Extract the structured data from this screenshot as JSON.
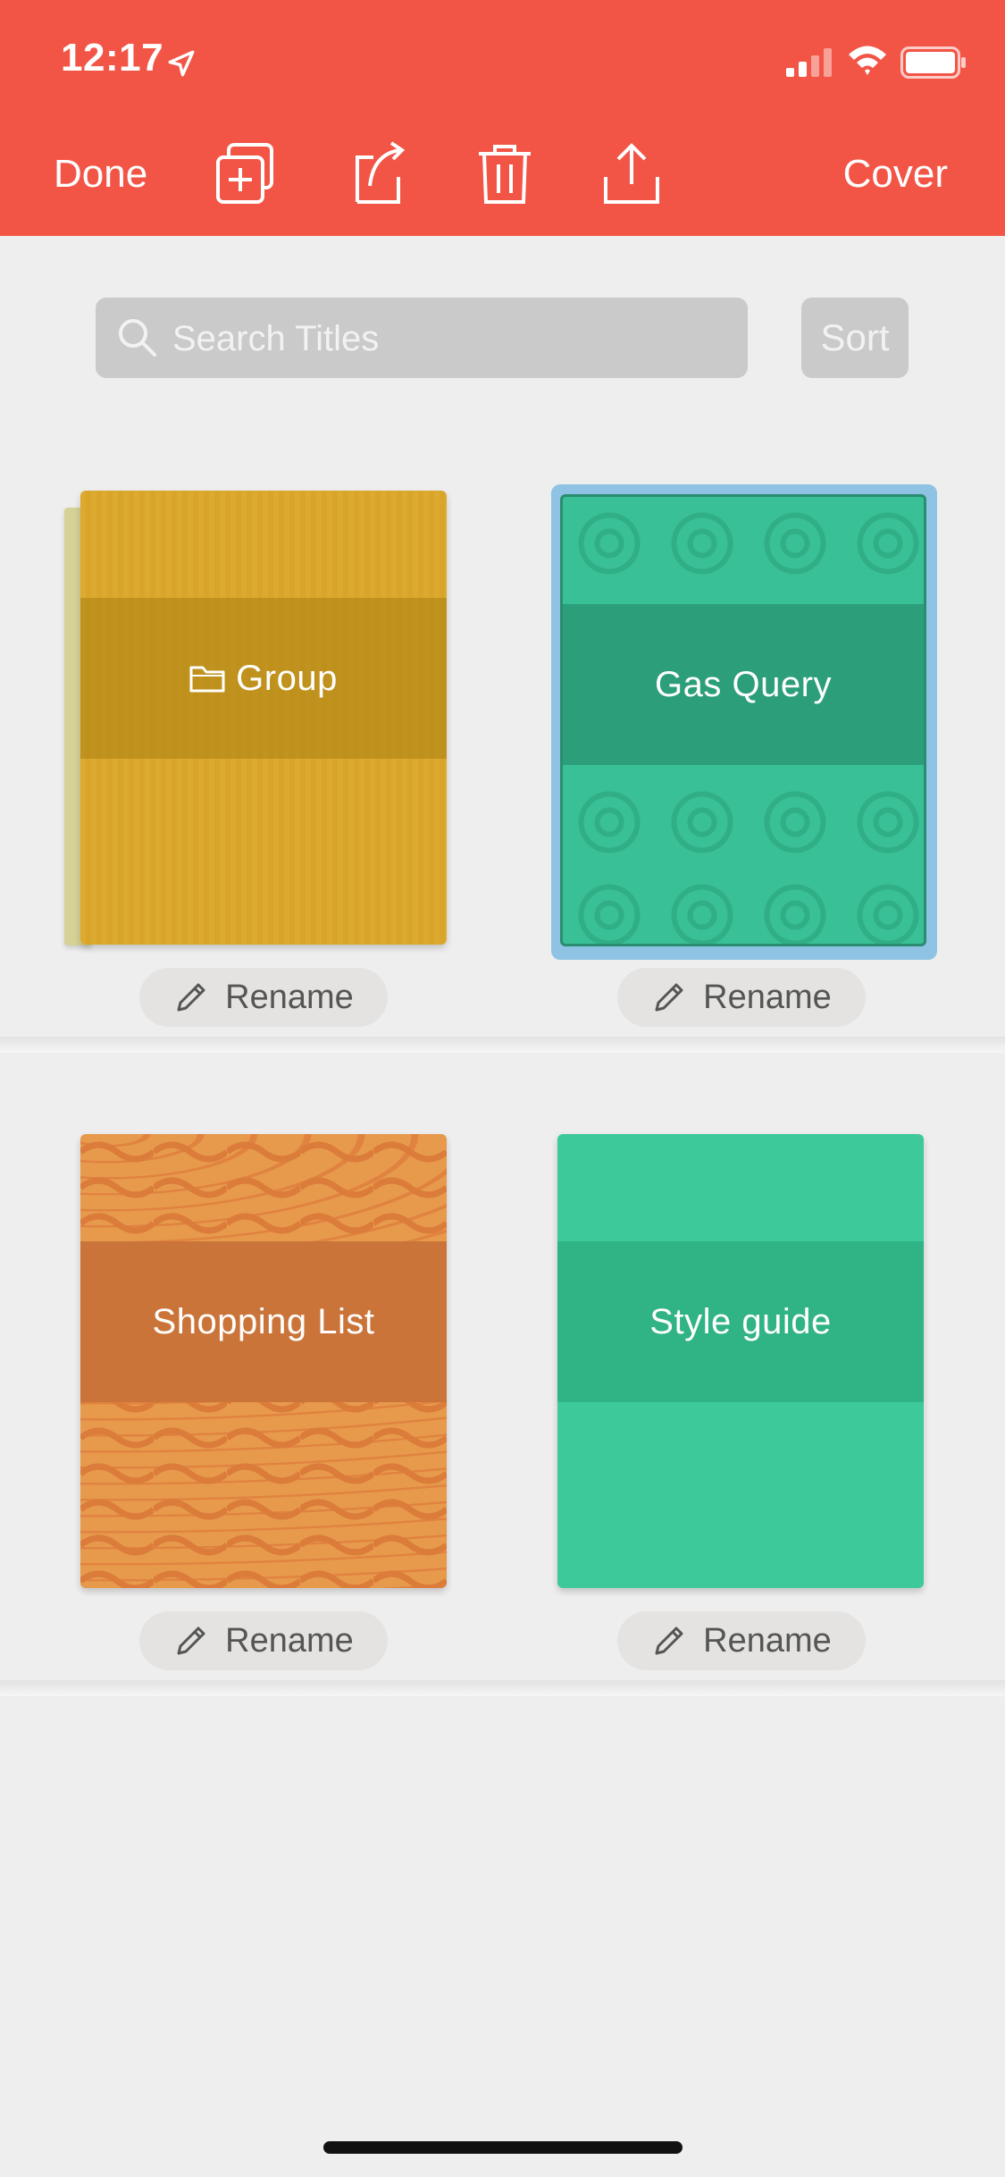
{
  "status_bar": {
    "time": "12:17",
    "icons": [
      "location-arrow-icon",
      "cellular-signal-icon",
      "wifi-icon",
      "battery-icon"
    ]
  },
  "toolbar": {
    "done_label": "Done",
    "cover_label": "Cover",
    "icons": [
      "duplicate-icon",
      "move-icon",
      "trash-icon",
      "share-icon"
    ],
    "background_color": "#f25546"
  },
  "search": {
    "placeholder": "Search Titles",
    "value": "",
    "sort_label": "Sort"
  },
  "items": [
    {
      "title": "Group",
      "type": "folder",
      "color": "#dcaa2e",
      "rename_label": "Rename",
      "selected": false
    },
    {
      "title": "Gas Query",
      "type": "document",
      "color": "#3ac096",
      "rename_label": "Rename",
      "selected": true
    },
    {
      "title": "Shopping List",
      "type": "document",
      "color": "#e79a4c",
      "rename_label": "Rename",
      "selected": false
    },
    {
      "title": "Style guide",
      "type": "document",
      "color": "#3ec99a",
      "rename_label": "Rename",
      "selected": false
    }
  ]
}
